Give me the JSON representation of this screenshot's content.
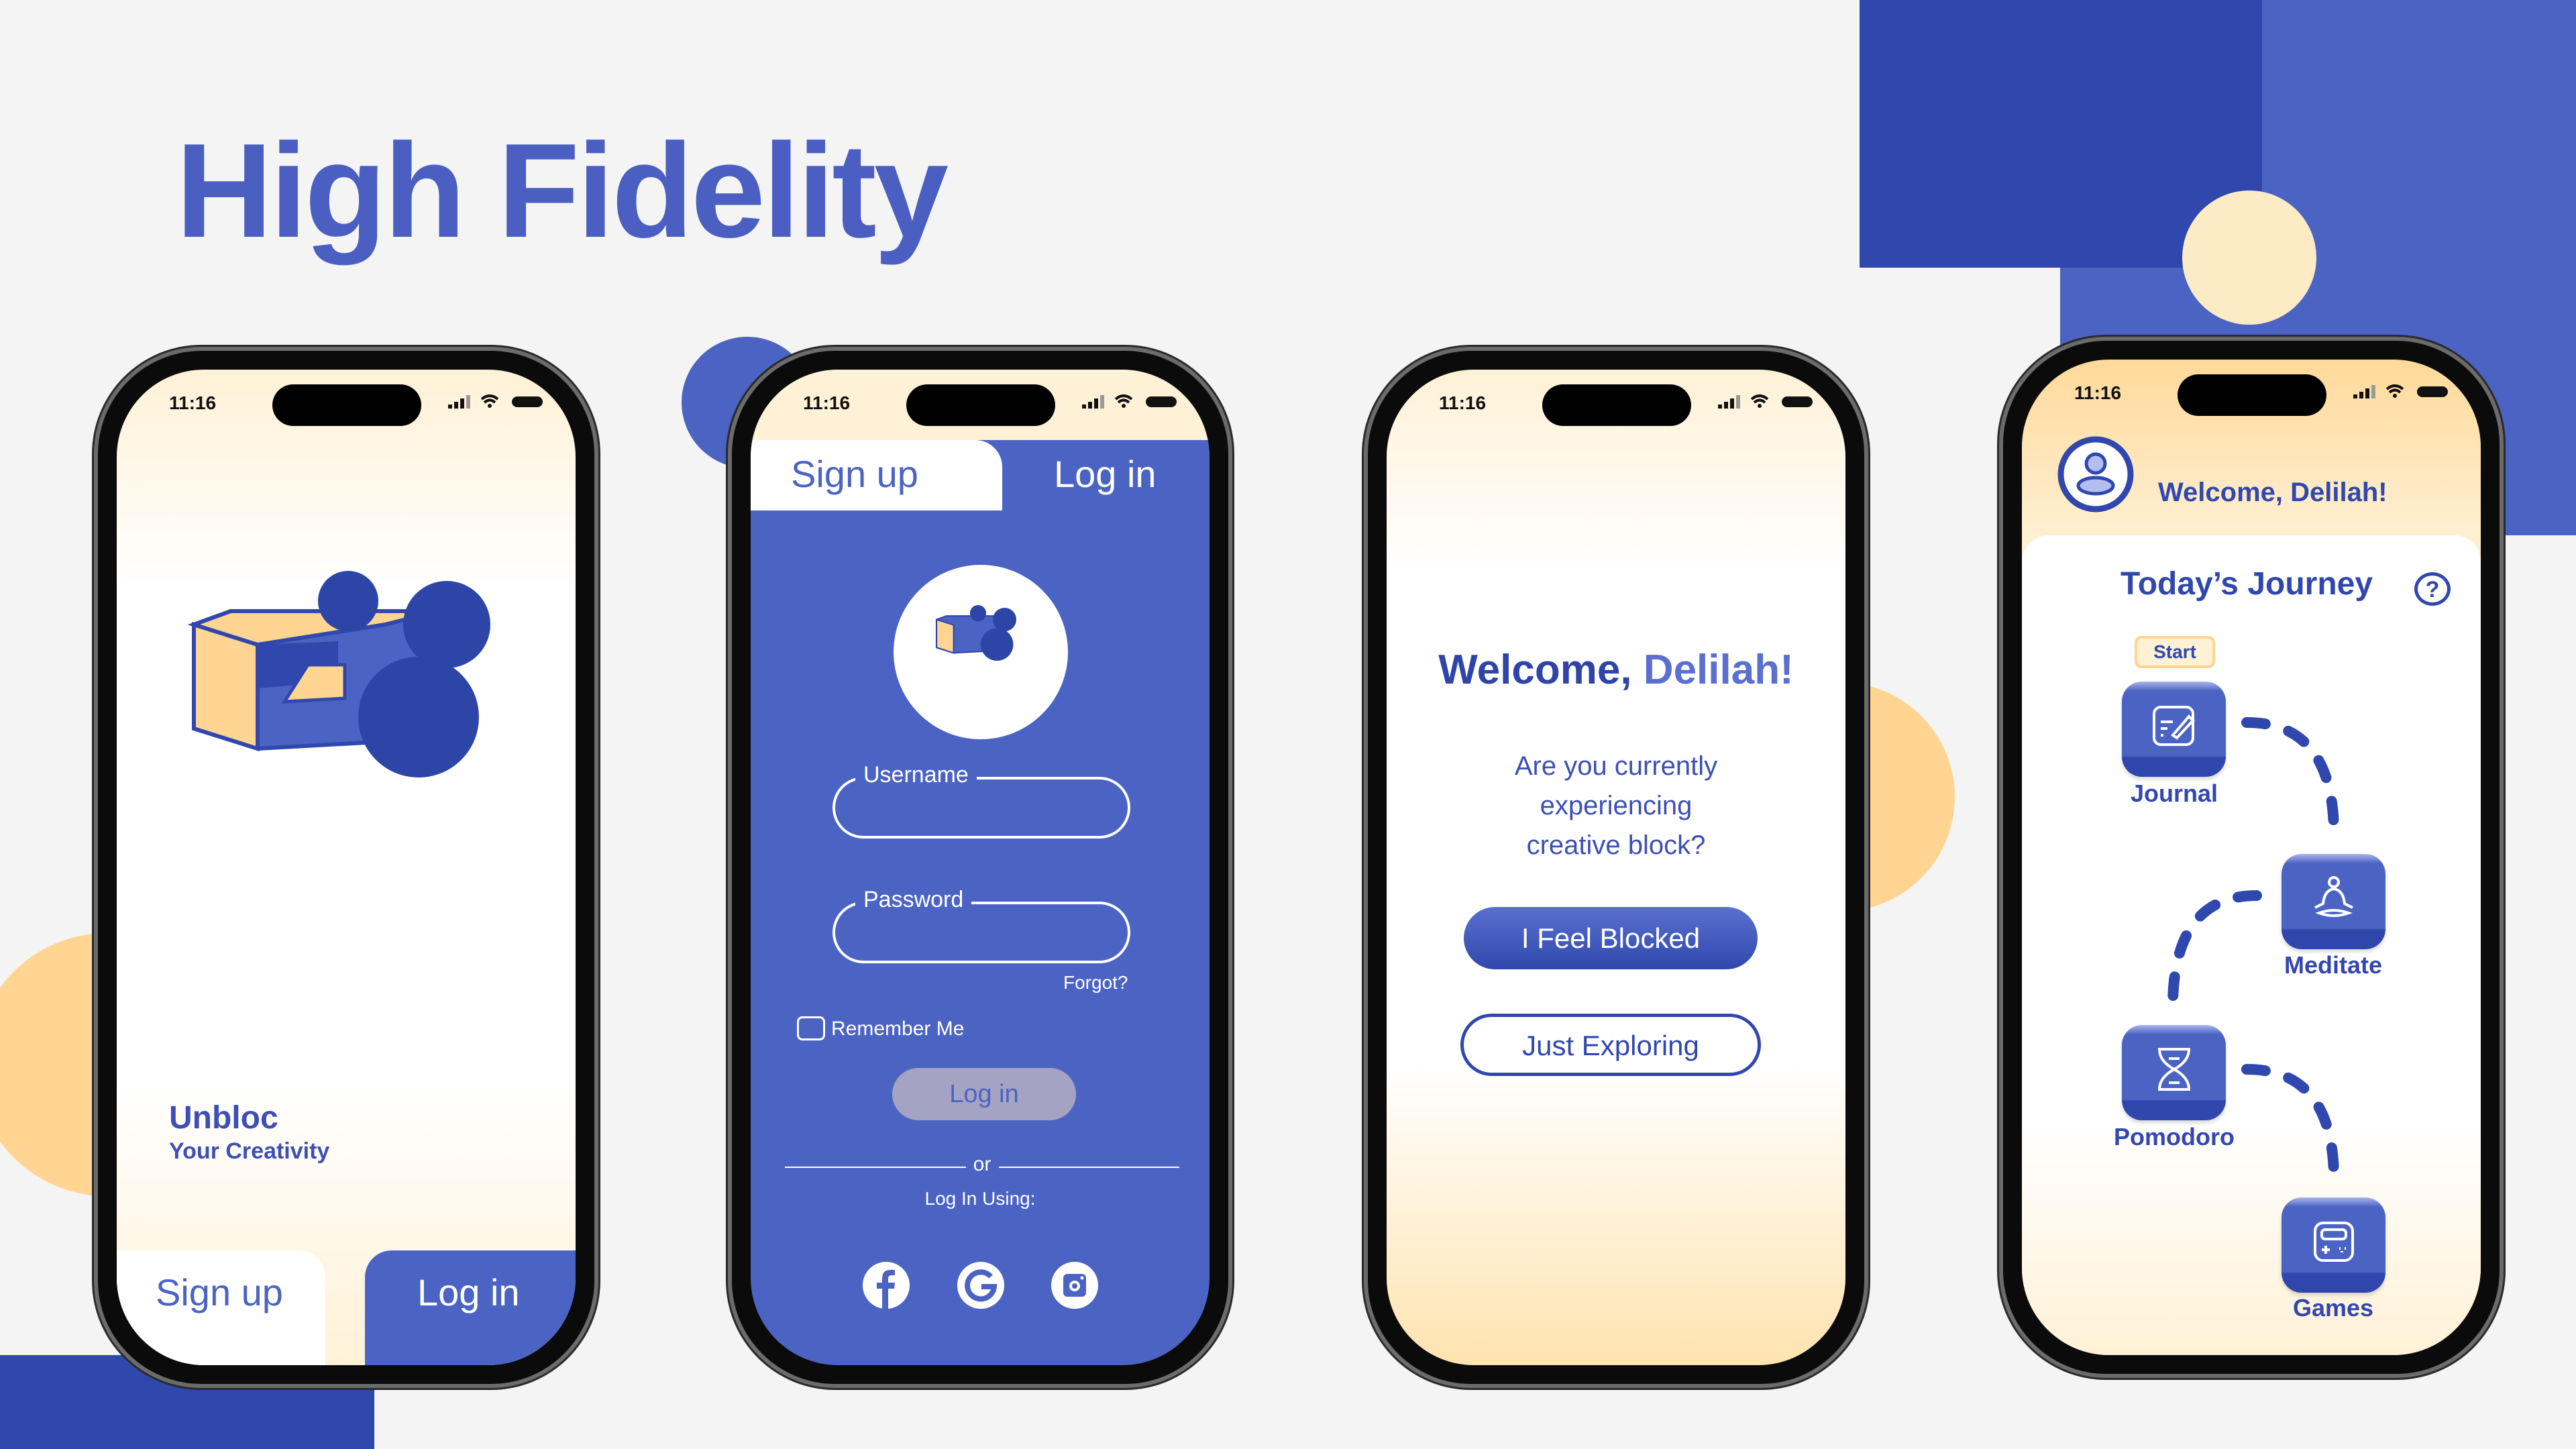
{
  "title": "High Fidelity",
  "colors": {
    "brand_blue": "#4b63c2",
    "dark_blue": "#3048ad",
    "peach": "#ffd591",
    "cream": "#fff1d6"
  },
  "status_bar": {
    "time": "11:16"
  },
  "phone1": {
    "app_name": "Unbloc",
    "tagline": "Your Creativity",
    "signup_tab": "Sign up",
    "login_tab": "Log in"
  },
  "phone2": {
    "signup_tab": "Sign up",
    "login_tab": "Log in",
    "username_label": "Username",
    "password_label": "Password",
    "forgot": "Forgot?",
    "remember_me": "Remember Me",
    "login_button": "Log in",
    "or": "or",
    "login_using": "Log In Using:",
    "social": [
      "facebook-icon",
      "google-icon",
      "instagram-icon"
    ]
  },
  "phone3": {
    "welcome_prefix": "Welcome, ",
    "name": "Delilah!",
    "question_lines": [
      "Are you currently",
      "experiencing",
      "creative block?"
    ],
    "blocked_button": "I Feel Blocked",
    "exploring_button": "Just Exploring"
  },
  "phone4": {
    "welcome": "Welcome, Delilah!",
    "journey_title": "Today’s Journey",
    "help": "?",
    "start_badge": "Start",
    "steps": [
      {
        "label": "Journal",
        "icon": "journal-icon"
      },
      {
        "label": "Meditate",
        "icon": "meditate-icon"
      },
      {
        "label": "Pomodoro",
        "icon": "hourglass-icon"
      },
      {
        "label": "Games",
        "icon": "gamepad-icon"
      }
    ]
  }
}
